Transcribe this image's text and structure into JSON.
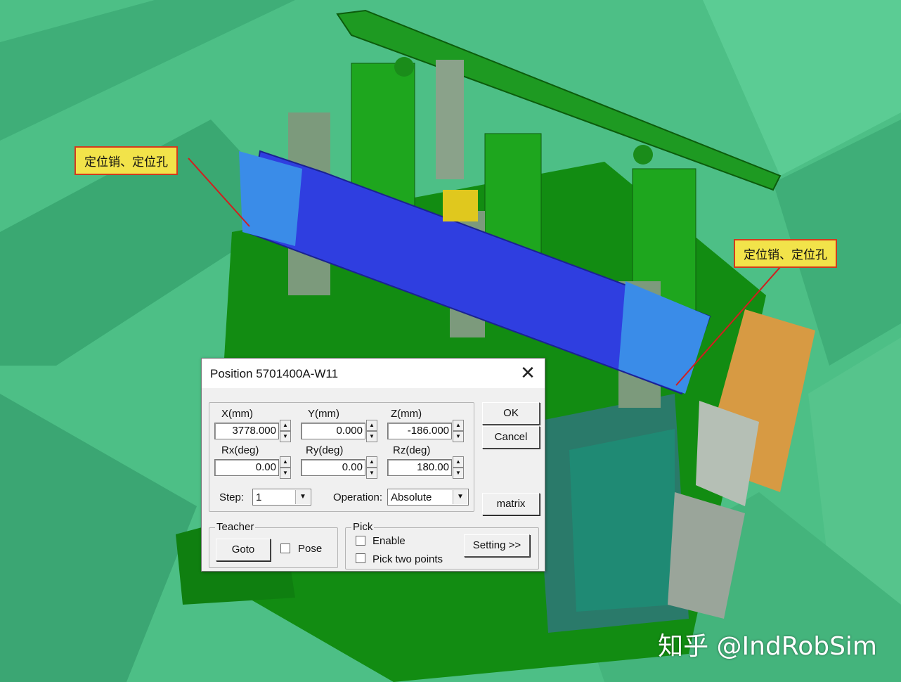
{
  "scene": {
    "callouts": [
      "定位销、定位孔",
      "定位销、定位孔"
    ],
    "watermark": "知乎 @IndRobSim",
    "colors": {
      "floor": "#4dbf86",
      "fixture_green": "#128c12",
      "part_blue": "#2f3ee0",
      "callout_bg": "#f2e34a",
      "callout_border": "#d23b1e"
    }
  },
  "dialog": {
    "title": "Position 5701400A-W11",
    "close_icon": "close-icon",
    "fields": [
      {
        "label": "X(mm)",
        "value": "3778.000"
      },
      {
        "label": "Y(mm)",
        "value": "0.000"
      },
      {
        "label": "Z(mm)",
        "value": "-186.000"
      },
      {
        "label": "Rx(deg)",
        "value": "0.00"
      },
      {
        "label": "Ry(deg)",
        "value": "0.00"
      },
      {
        "label": "Rz(deg)",
        "value": "180.00"
      }
    ],
    "step": {
      "label": "Step:",
      "value": "1"
    },
    "operation": {
      "label": "Operation:",
      "value": "Absolute"
    },
    "buttons": {
      "ok": "OK",
      "cancel": "Cancel",
      "matrix": "matrix"
    },
    "teacher": {
      "legend": "Teacher",
      "goto": "Goto",
      "pose": "Pose"
    },
    "pick": {
      "legend": "Pick",
      "enable": "Enable",
      "two_points": "Pick two points",
      "setting": "Setting >>"
    }
  }
}
